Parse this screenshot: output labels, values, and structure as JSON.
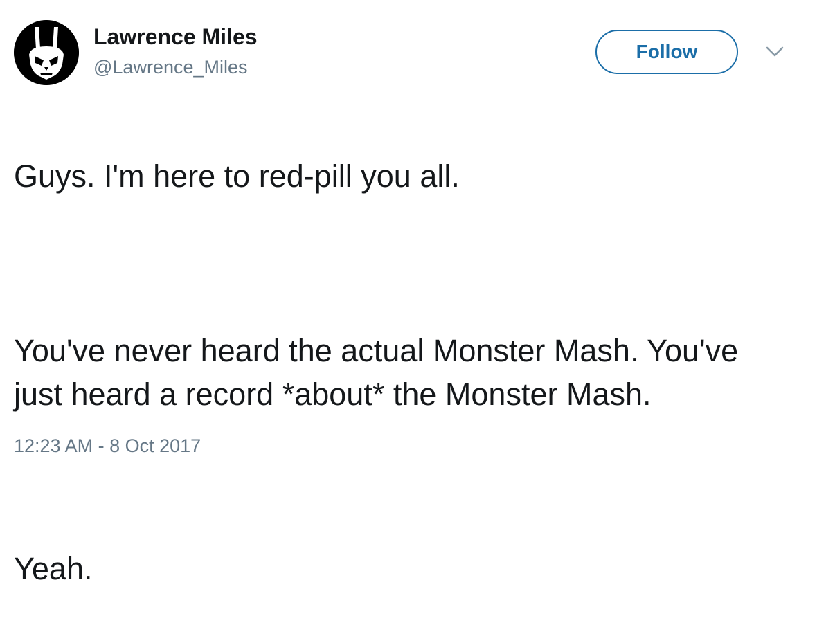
{
  "author": {
    "display_name": "Lawrence Miles",
    "handle": "@Lawrence_Miles",
    "avatar_icon": "rabbit-skull-icon"
  },
  "actions": {
    "follow_label": "Follow",
    "menu_icon": "chevron-down-icon",
    "accent_color": "#1b6ea8"
  },
  "tweet": {
    "paragraphs": [
      "Guys. I'm here to red-pill you all.",
      "You've never heard the actual Monster Mash. You've just heard a record *about* the Monster Mash.",
      "Yeah."
    ],
    "timestamp": "12:23 AM - 8 Oct 2017"
  }
}
